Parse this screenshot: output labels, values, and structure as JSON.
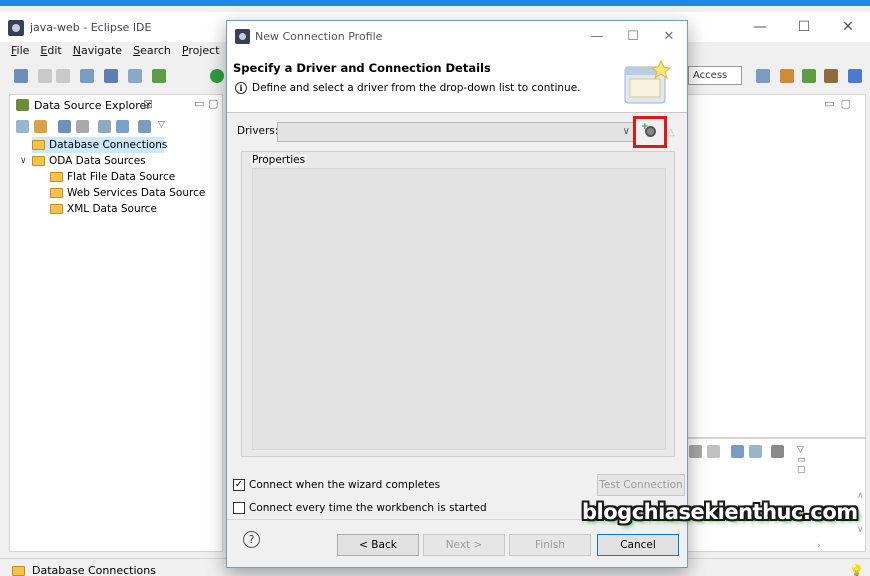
{
  "window": {
    "title": "java-web - Eclipse IDE",
    "controls": {
      "minimize": "—",
      "maximize": "☐",
      "close": "✕"
    }
  },
  "menubar": [
    "File",
    "Edit",
    "Navigate",
    "Search",
    "Project"
  ],
  "toolbar": {
    "quick_access": "Access"
  },
  "explorer": {
    "tab_label": "Data Source Explorer",
    "tab_close": "☒",
    "minimize": "▭",
    "maximize": "▢",
    "tree": [
      {
        "label": "Database Connections",
        "selected": true
      },
      {
        "label": "ODA Data Sources",
        "expanded": true
      },
      {
        "label": "Flat File Data Source"
      },
      {
        "label": "Web Services Data Source"
      },
      {
        "label": "XML Data Source"
      }
    ]
  },
  "statusbar": {
    "text": "Database Connections"
  },
  "dialog": {
    "title": "New Connection Profile",
    "controls": {
      "minimize": "—",
      "maximize": "☐",
      "close": "✕"
    },
    "heading": "Specify a Driver and Connection Details",
    "description": "Define and select a driver from the drop-down list to continue.",
    "info_glyph": "i",
    "drivers_label": "Drivers:",
    "drivers_value": "",
    "properties_label": "Properties",
    "connect_on_complete": {
      "label": "Connect when the wizard completes",
      "checked": true
    },
    "connect_every_time": {
      "label": "Connect every time the workbench is started",
      "checked": false
    },
    "test_connection": "Test Connection",
    "help_glyph": "?",
    "buttons": {
      "back": "< Back",
      "next": "Next >",
      "finish": "Finish",
      "cancel": "Cancel"
    }
  },
  "watermark": "blogchiasekienthuc.com",
  "colors": {
    "highlight_box": "#e01818",
    "selection": "#cce8ff",
    "accent": "#1e88e5"
  }
}
